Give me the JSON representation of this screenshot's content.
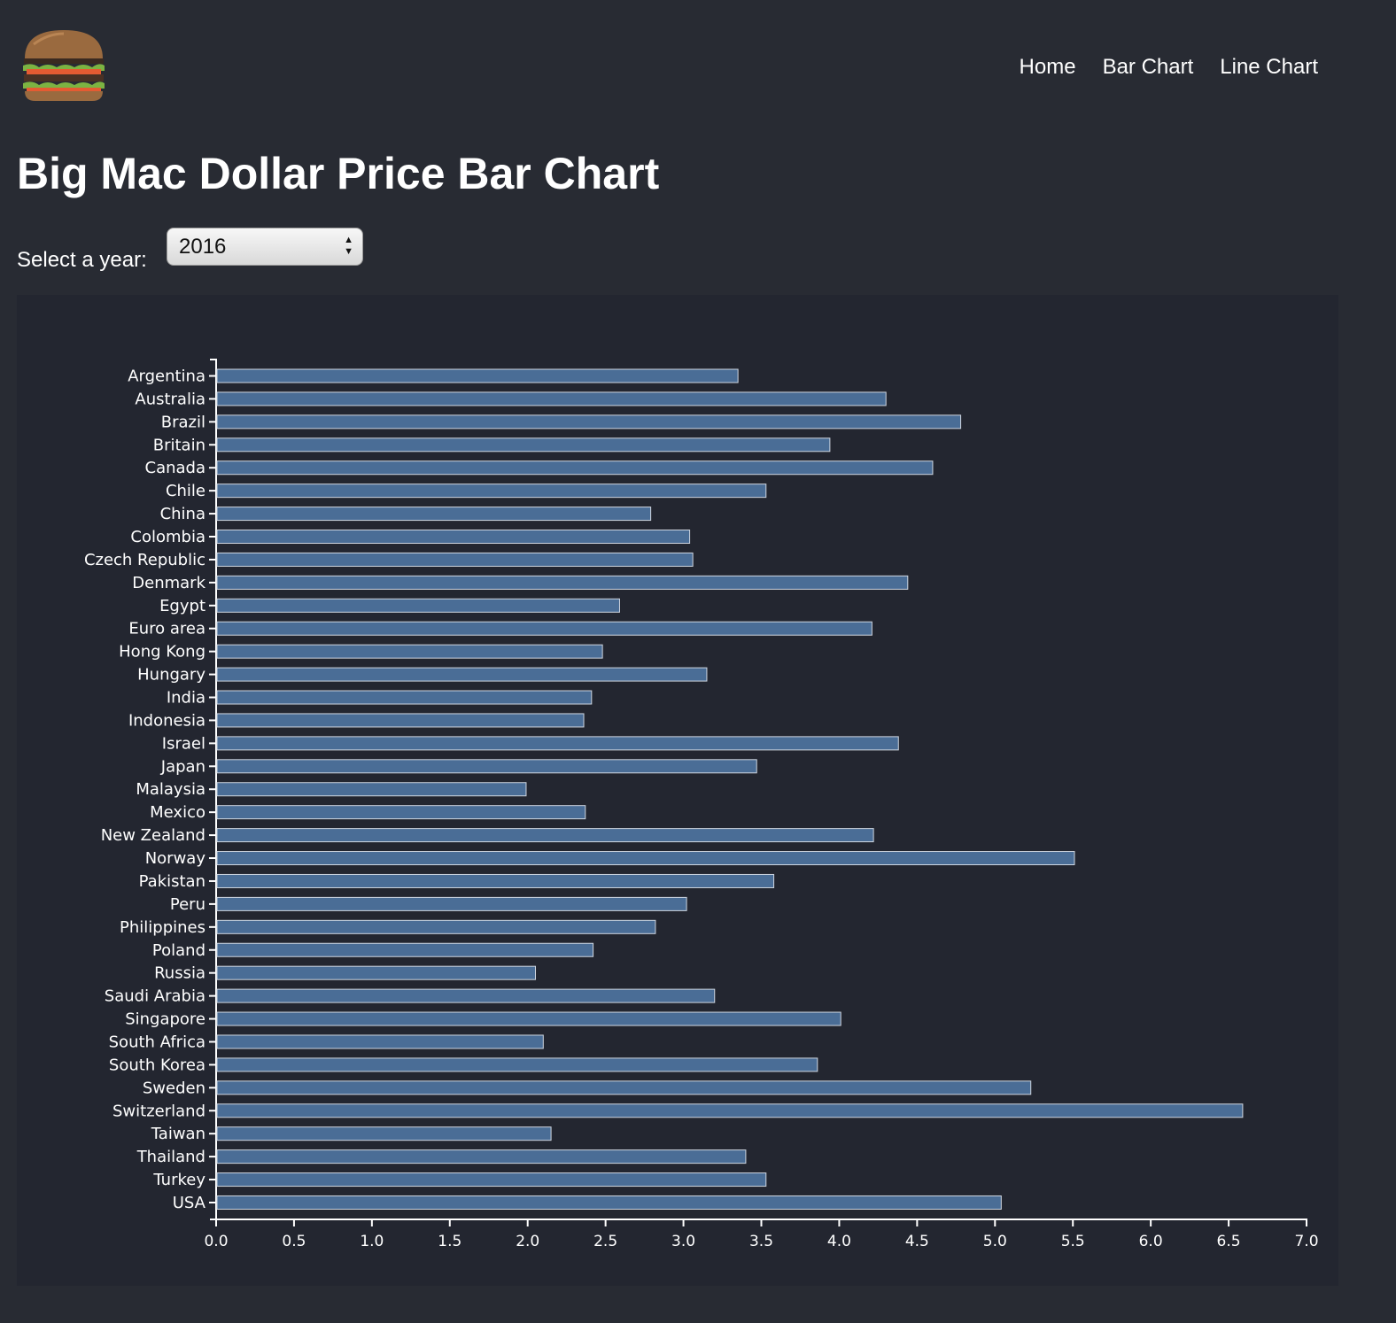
{
  "header": {
    "nav": [
      "Home",
      "Bar Chart",
      "Line Chart"
    ]
  },
  "page": {
    "title": "Big Mac Dollar Price Bar Chart",
    "year_label": "Select a year:",
    "year_value": "2016"
  },
  "colors": {
    "background": "#282b33",
    "chart_background": "#232630",
    "bar_fill": "#4a6d96",
    "bar_stroke": "#cfd6e0"
  },
  "chart_data": {
    "type": "bar",
    "orientation": "horizontal",
    "title": "",
    "xlabel": "",
    "ylabel": "",
    "xlim": [
      0,
      7.0
    ],
    "x_ticks": [
      "0.0",
      "0.5",
      "1.0",
      "1.5",
      "2.0",
      "2.5",
      "3.0",
      "3.5",
      "4.0",
      "4.5",
      "5.0",
      "5.5",
      "6.0",
      "6.5",
      "7.0"
    ],
    "grid": false,
    "categories": [
      "Argentina",
      "Australia",
      "Brazil",
      "Britain",
      "Canada",
      "Chile",
      "China",
      "Colombia",
      "Czech Republic",
      "Denmark",
      "Egypt",
      "Euro area",
      "Hong Kong",
      "Hungary",
      "India",
      "Indonesia",
      "Israel",
      "Japan",
      "Malaysia",
      "Mexico",
      "New Zealand",
      "Norway",
      "Pakistan",
      "Peru",
      "Philippines",
      "Poland",
      "Russia",
      "Saudi Arabia",
      "Singapore",
      "South Africa",
      "South Korea",
      "Sweden",
      "Switzerland",
      "Taiwan",
      "Thailand",
      "Turkey",
      "USA"
    ],
    "values": [
      3.35,
      4.3,
      4.78,
      3.94,
      4.6,
      3.53,
      2.79,
      3.04,
      3.06,
      4.44,
      2.59,
      4.21,
      2.48,
      3.15,
      2.41,
      2.36,
      4.38,
      3.47,
      1.99,
      2.37,
      4.22,
      5.51,
      3.58,
      3.02,
      2.82,
      2.42,
      2.05,
      3.2,
      4.01,
      2.1,
      3.86,
      5.23,
      6.59,
      2.15,
      3.4,
      3.53,
      5.04
    ]
  }
}
